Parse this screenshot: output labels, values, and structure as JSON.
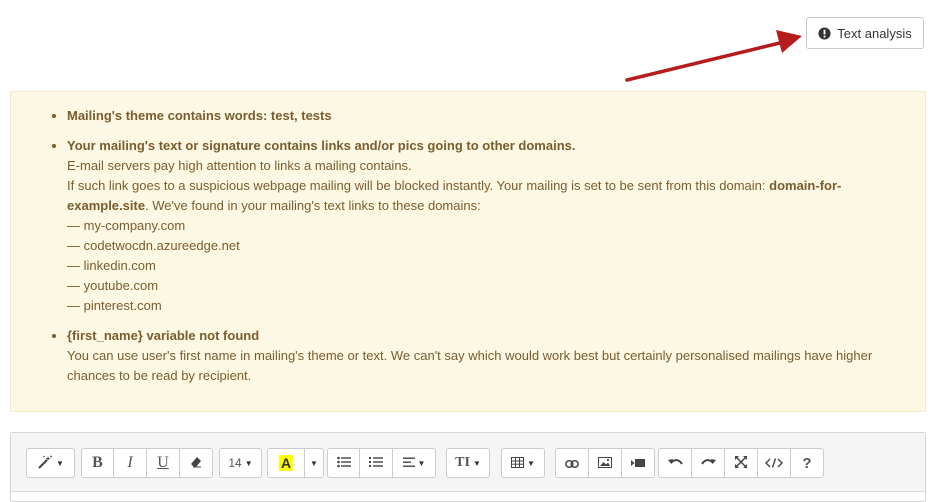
{
  "header": {
    "analysis_button_label": "Text analysis",
    "analysis_icon": "exclamation-circle-icon"
  },
  "annotation": {
    "arrow_color": "#b71c1c"
  },
  "warnings": {
    "theme_words": {
      "title": "Mailing's theme contains words: test, tests"
    },
    "links": {
      "title": "Your mailing's text or signature contains links and/or pics going to other domains.",
      "line1": "E-mail servers pay high attention to links a mailing contains.",
      "line2_prefix": "If such link goes to a suspicious webpage mailing will be blocked instantly. Your mailing is set to be sent from this domain: ",
      "own_domain": "domain-for-example.site",
      "line2_suffix": ". We've found in your mailing's text links to these domains:",
      "domains": [
        "— my-company.com",
        "— codetwocdn.azureedge.net",
        "— linkedin.com",
        "— youtube.com",
        "— pinterest.com"
      ]
    },
    "first_name": {
      "title": "{first_name} variable not found",
      "text": "You can use user's first name in mailing's theme or text. We can't say which would work best but certainly personalised mailings have higher chances to be read by recipient."
    }
  },
  "editor": {
    "font_size": "14",
    "bold": "B",
    "italic": "I",
    "underline": "U",
    "text_style": "TI",
    "help": "?",
    "highlight_letter": "A",
    "highlight_color": "#ffff00",
    "colors": {
      "box_bg": "#fcf8e3",
      "box_text": "#7a5c2e"
    }
  }
}
